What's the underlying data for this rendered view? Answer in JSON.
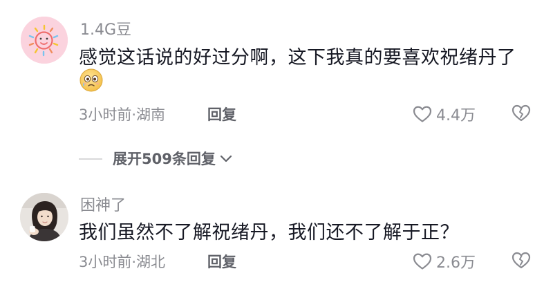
{
  "comments": [
    {
      "username": "1.4G豆",
      "text": "感觉这话说的好过分啊，这下我真的要喜欢祝绪丹了",
      "emoji": "smiling-face-with-tear-emoji",
      "meta": "3小时前·湖南",
      "reply_label": "回复",
      "likes": "4.4万",
      "expand_replies": "展开509条回复"
    },
    {
      "username": "困神了",
      "text": "我们虽然不了解祝绪丹，我们还不了解于正？",
      "meta": "3小时前·湖北",
      "reply_label": "回复",
      "likes": "2.6万"
    }
  ],
  "colors": {
    "text_primary": "#161823",
    "text_secondary": "#8a8b91",
    "avatar_pink": "#fbd3de"
  }
}
